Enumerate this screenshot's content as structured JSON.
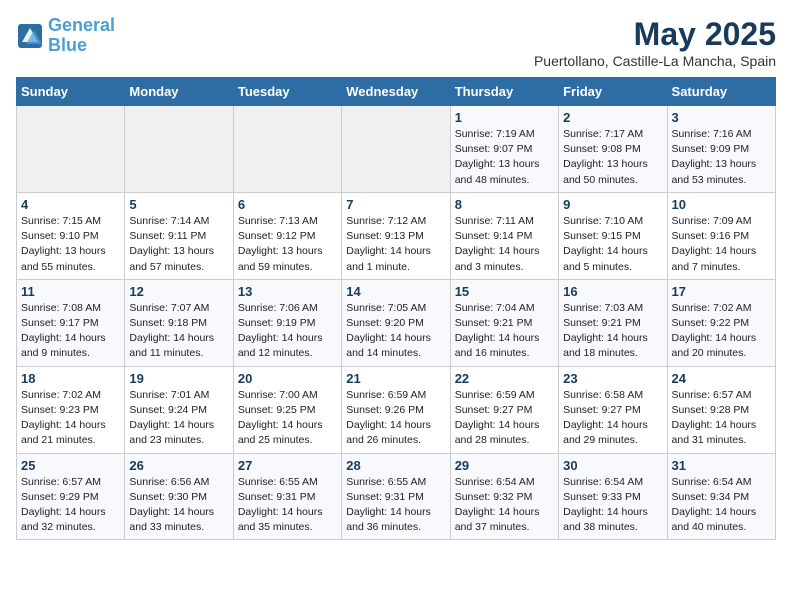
{
  "logo": {
    "line1": "General",
    "line2": "Blue"
  },
  "title": "May 2025",
  "subtitle": "Puertollano, Castille-La Mancha, Spain",
  "weekdays": [
    "Sunday",
    "Monday",
    "Tuesday",
    "Wednesday",
    "Thursday",
    "Friday",
    "Saturday"
  ],
  "weeks": [
    [
      {
        "day": "",
        "info": ""
      },
      {
        "day": "",
        "info": ""
      },
      {
        "day": "",
        "info": ""
      },
      {
        "day": "",
        "info": ""
      },
      {
        "day": "1",
        "info": "Sunrise: 7:19 AM\nSunset: 9:07 PM\nDaylight: 13 hours\nand 48 minutes."
      },
      {
        "day": "2",
        "info": "Sunrise: 7:17 AM\nSunset: 9:08 PM\nDaylight: 13 hours\nand 50 minutes."
      },
      {
        "day": "3",
        "info": "Sunrise: 7:16 AM\nSunset: 9:09 PM\nDaylight: 13 hours\nand 53 minutes."
      }
    ],
    [
      {
        "day": "4",
        "info": "Sunrise: 7:15 AM\nSunset: 9:10 PM\nDaylight: 13 hours\nand 55 minutes."
      },
      {
        "day": "5",
        "info": "Sunrise: 7:14 AM\nSunset: 9:11 PM\nDaylight: 13 hours\nand 57 minutes."
      },
      {
        "day": "6",
        "info": "Sunrise: 7:13 AM\nSunset: 9:12 PM\nDaylight: 13 hours\nand 59 minutes."
      },
      {
        "day": "7",
        "info": "Sunrise: 7:12 AM\nSunset: 9:13 PM\nDaylight: 14 hours\nand 1 minute."
      },
      {
        "day": "8",
        "info": "Sunrise: 7:11 AM\nSunset: 9:14 PM\nDaylight: 14 hours\nand 3 minutes."
      },
      {
        "day": "9",
        "info": "Sunrise: 7:10 AM\nSunset: 9:15 PM\nDaylight: 14 hours\nand 5 minutes."
      },
      {
        "day": "10",
        "info": "Sunrise: 7:09 AM\nSunset: 9:16 PM\nDaylight: 14 hours\nand 7 minutes."
      }
    ],
    [
      {
        "day": "11",
        "info": "Sunrise: 7:08 AM\nSunset: 9:17 PM\nDaylight: 14 hours\nand 9 minutes."
      },
      {
        "day": "12",
        "info": "Sunrise: 7:07 AM\nSunset: 9:18 PM\nDaylight: 14 hours\nand 11 minutes."
      },
      {
        "day": "13",
        "info": "Sunrise: 7:06 AM\nSunset: 9:19 PM\nDaylight: 14 hours\nand 12 minutes."
      },
      {
        "day": "14",
        "info": "Sunrise: 7:05 AM\nSunset: 9:20 PM\nDaylight: 14 hours\nand 14 minutes."
      },
      {
        "day": "15",
        "info": "Sunrise: 7:04 AM\nSunset: 9:21 PM\nDaylight: 14 hours\nand 16 minutes."
      },
      {
        "day": "16",
        "info": "Sunrise: 7:03 AM\nSunset: 9:21 PM\nDaylight: 14 hours\nand 18 minutes."
      },
      {
        "day": "17",
        "info": "Sunrise: 7:02 AM\nSunset: 9:22 PM\nDaylight: 14 hours\nand 20 minutes."
      }
    ],
    [
      {
        "day": "18",
        "info": "Sunrise: 7:02 AM\nSunset: 9:23 PM\nDaylight: 14 hours\nand 21 minutes."
      },
      {
        "day": "19",
        "info": "Sunrise: 7:01 AM\nSunset: 9:24 PM\nDaylight: 14 hours\nand 23 minutes."
      },
      {
        "day": "20",
        "info": "Sunrise: 7:00 AM\nSunset: 9:25 PM\nDaylight: 14 hours\nand 25 minutes."
      },
      {
        "day": "21",
        "info": "Sunrise: 6:59 AM\nSunset: 9:26 PM\nDaylight: 14 hours\nand 26 minutes."
      },
      {
        "day": "22",
        "info": "Sunrise: 6:59 AM\nSunset: 9:27 PM\nDaylight: 14 hours\nand 28 minutes."
      },
      {
        "day": "23",
        "info": "Sunrise: 6:58 AM\nSunset: 9:27 PM\nDaylight: 14 hours\nand 29 minutes."
      },
      {
        "day": "24",
        "info": "Sunrise: 6:57 AM\nSunset: 9:28 PM\nDaylight: 14 hours\nand 31 minutes."
      }
    ],
    [
      {
        "day": "25",
        "info": "Sunrise: 6:57 AM\nSunset: 9:29 PM\nDaylight: 14 hours\nand 32 minutes."
      },
      {
        "day": "26",
        "info": "Sunrise: 6:56 AM\nSunset: 9:30 PM\nDaylight: 14 hours\nand 33 minutes."
      },
      {
        "day": "27",
        "info": "Sunrise: 6:55 AM\nSunset: 9:31 PM\nDaylight: 14 hours\nand 35 minutes."
      },
      {
        "day": "28",
        "info": "Sunrise: 6:55 AM\nSunset: 9:31 PM\nDaylight: 14 hours\nand 36 minutes."
      },
      {
        "day": "29",
        "info": "Sunrise: 6:54 AM\nSunset: 9:32 PM\nDaylight: 14 hours\nand 37 minutes."
      },
      {
        "day": "30",
        "info": "Sunrise: 6:54 AM\nSunset: 9:33 PM\nDaylight: 14 hours\nand 38 minutes."
      },
      {
        "day": "31",
        "info": "Sunrise: 6:54 AM\nSunset: 9:34 PM\nDaylight: 14 hours\nand 40 minutes."
      }
    ]
  ]
}
